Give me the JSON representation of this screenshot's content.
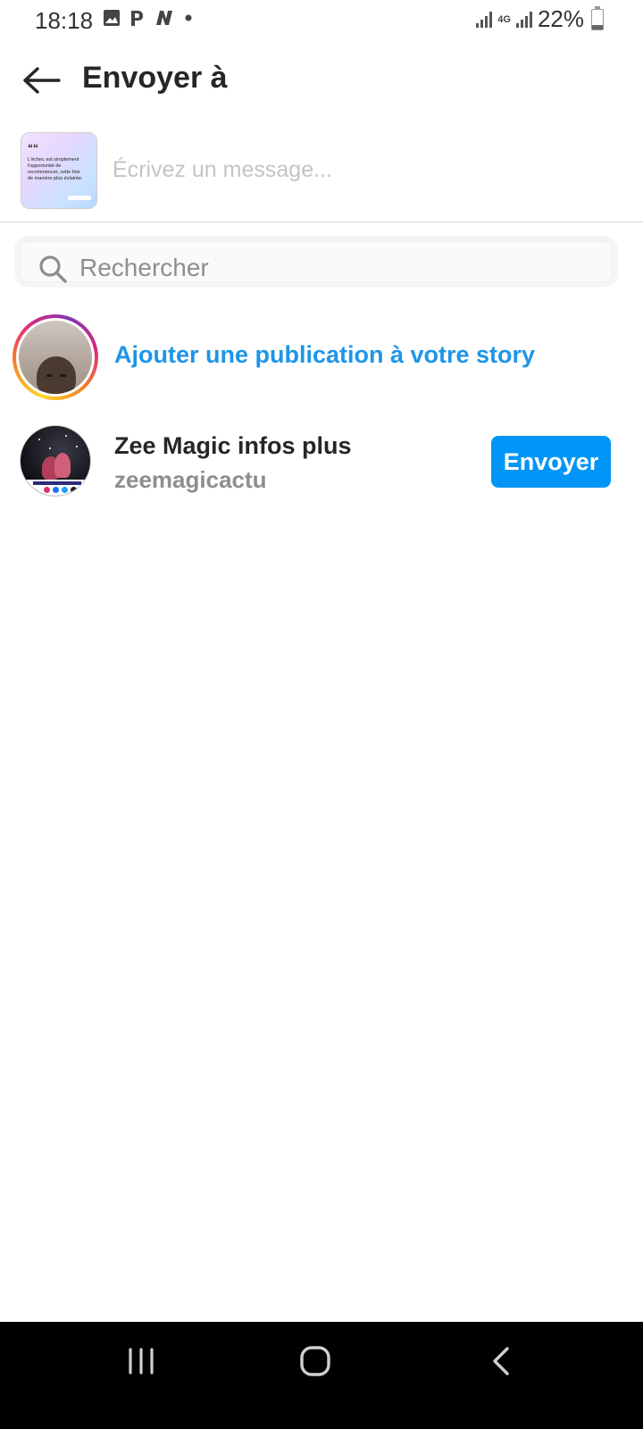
{
  "status_bar": {
    "time": "18:18",
    "network": "4G",
    "battery": "22%",
    "battery_level": 0.22
  },
  "header": {
    "title": "Envoyer à",
    "back_icon": "arrow-left-icon"
  },
  "compose": {
    "message_placeholder": "Écrivez un message...",
    "message_value": "",
    "thumbnail": {
      "quote_text": "L'échec est simplement l'opportunité de recommencer, cette fois de manière plus éclairée."
    }
  },
  "search": {
    "placeholder": "Rechercher",
    "value": "",
    "icon": "search-icon"
  },
  "story": {
    "label": "Ajouter une publication à votre story"
  },
  "contacts": [
    {
      "name": "Zee Magic infos plus",
      "handle": "zeemagicactu",
      "action_label": "Envoyer"
    }
  ],
  "nav_bar": {
    "recents_icon": "recents-icon",
    "home_icon": "home-icon",
    "back_icon": "back-chevron-icon"
  },
  "colors": {
    "accent": "#0095f6",
    "story_link": "#1d95e8",
    "primary_text": "#262626",
    "secondary_text": "#8e8e8e",
    "nav_bar_bg": "#000000"
  }
}
